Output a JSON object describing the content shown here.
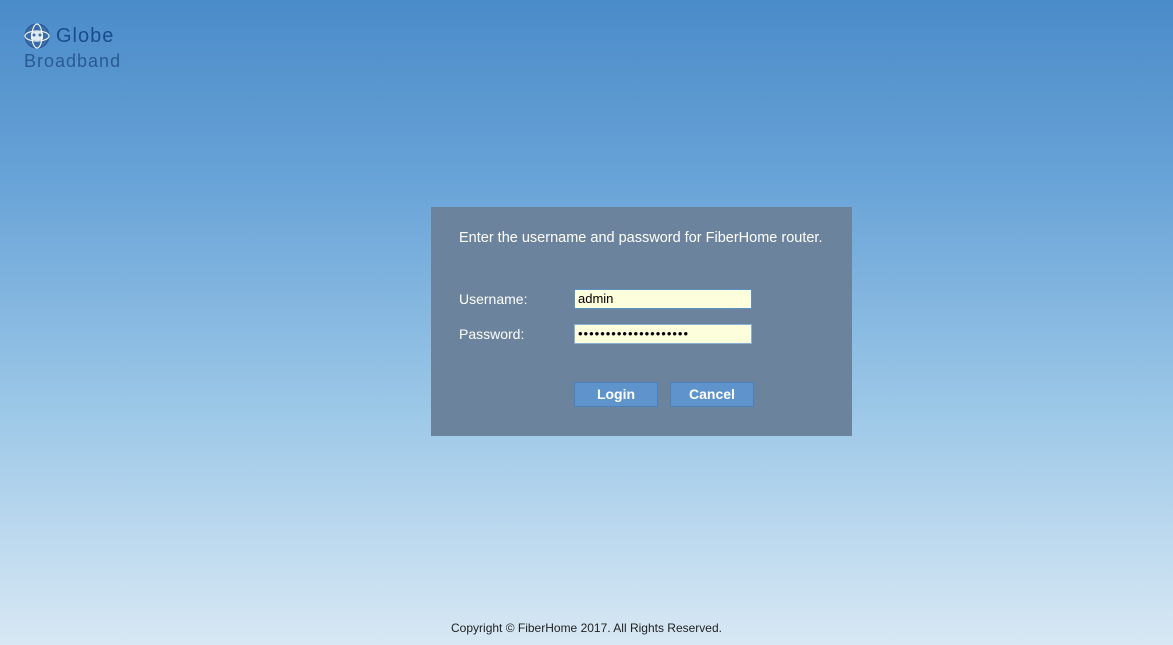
{
  "branding": {
    "company": "Globe",
    "subtitle": "Broadband"
  },
  "login": {
    "instruction": "Enter the username and password for FiberHome router.",
    "username_label": "Username:",
    "password_label": "Password:",
    "username_value": "admin",
    "password_value": "••••••••••••••••••••",
    "login_button": "Login",
    "cancel_button": "Cancel"
  },
  "footer": {
    "copyright": "Copyright © FiberHome 2017. All Rights Reserved."
  }
}
